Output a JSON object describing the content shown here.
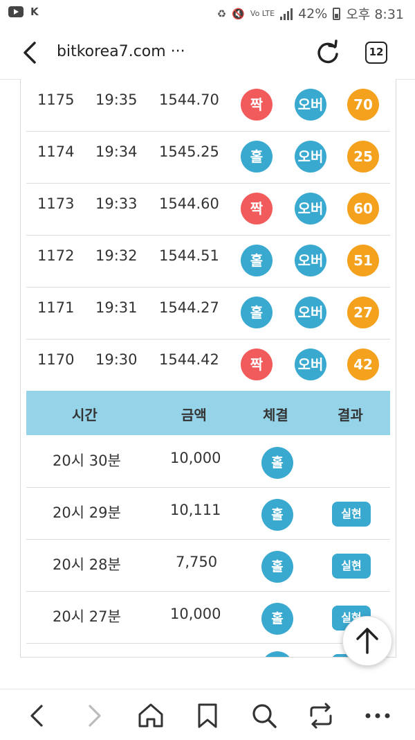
{
  "status_bar": {
    "carrier_glyph": "K",
    "volte": "Vo LTE",
    "battery": "42%",
    "time": "오후 8:31"
  },
  "browser": {
    "url": "bitkorea7.com ···",
    "tab_count": "12"
  },
  "game_rows": [
    {
      "round": "1175",
      "time": "19:35",
      "price": "1544.70",
      "odd_even": "짝",
      "over_under": "오버",
      "last_digits": "70",
      "odd_even_color": "#f25b5b"
    },
    {
      "round": "1174",
      "time": "19:34",
      "price": "1545.25",
      "odd_even": "홀",
      "over_under": "오버",
      "last_digits": "25",
      "odd_even_color": "#3aa9d0"
    },
    {
      "round": "1173",
      "time": "19:33",
      "price": "1544.60",
      "odd_even": "짝",
      "over_under": "오버",
      "last_digits": "60",
      "odd_even_color": "#f25b5b"
    },
    {
      "round": "1172",
      "time": "19:32",
      "price": "1544.51",
      "odd_even": "홀",
      "over_under": "오버",
      "last_digits": "51",
      "odd_even_color": "#3aa9d0"
    },
    {
      "round": "1171",
      "time": "19:31",
      "price": "1544.27",
      "odd_even": "홀",
      "over_under": "오버",
      "last_digits": "27",
      "odd_even_color": "#3aa9d0"
    },
    {
      "round": "1170",
      "time": "19:30",
      "price": "1544.42",
      "odd_even": "짝",
      "over_under": "오버",
      "last_digits": "42",
      "odd_even_color": "#f25b5b"
    }
  ],
  "bet_table": {
    "headers": {
      "time": "시간",
      "amount": "금액",
      "executed": "체결",
      "result": "결과"
    },
    "rows": [
      {
        "time": "20시 30분",
        "amount": "10,000",
        "executed": "홀",
        "result": ""
      },
      {
        "time": "20시 29분",
        "amount": "10,111",
        "executed": "홀",
        "result": "실현"
      },
      {
        "time": "20시 28분",
        "amount": "7,750",
        "executed": "홀",
        "result": "실현"
      },
      {
        "time": "20시 27분",
        "amount": "10,000",
        "executed": "홀",
        "result": "실현"
      }
    ]
  },
  "colors": {
    "odd": "#3aa9d0",
    "even": "#f25b5b",
    "digits": "#f4a11e",
    "header_bg": "#95d3e8"
  }
}
